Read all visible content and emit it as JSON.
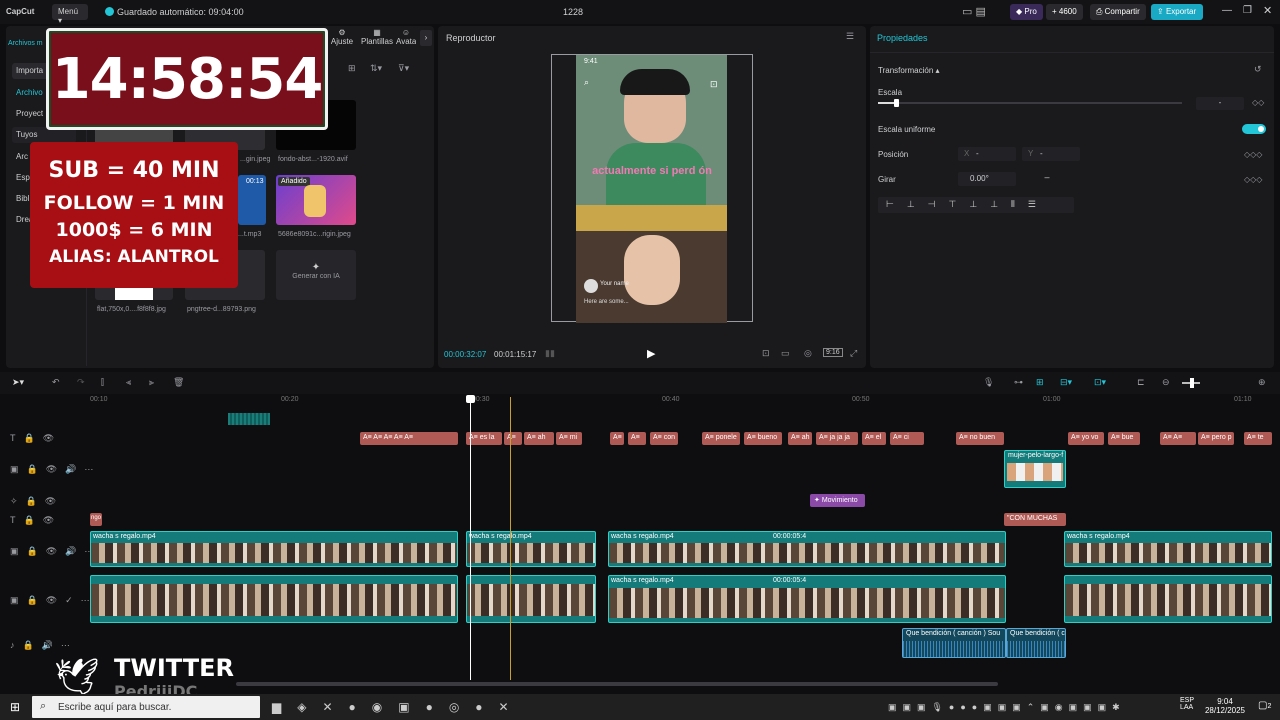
{
  "topbar": {
    "app_name": "CapCut",
    "menu_label": "Menú",
    "autosave": "Guardado automático: 09:04:00",
    "project_name": "1228",
    "pro_label": "Pro",
    "credits": "4600",
    "share_label": "Compartir",
    "export_label": "Exportar"
  },
  "media_tabs": {
    "items": [
      "Ajuste",
      "Plantillas",
      "Avata"
    ],
    "files_tab": "Archivos m"
  },
  "media_sidebar": {
    "items": [
      "Importa",
      "Archivo",
      "Proyect",
      "Tuyos",
      "Arc",
      "Esp",
      "Bibl",
      "Drea"
    ]
  },
  "media_files": [
    {
      "name": "...gin.jpeg"
    },
    {
      "name": "fondo-abst...-1920.avif"
    },
    {
      "name": "...t.mp3",
      "duration": "00:13"
    },
    {
      "name": "5686e8091c...rigin.jpeg",
      "badge": "Añadido"
    },
    {
      "name": "flat,750x,0....f8f8f8.jpg"
    },
    {
      "name": "pngtree-d...89793.png"
    }
  ],
  "media_gen": "Generar con IA",
  "overlays": {
    "clock": "14:58:54",
    "rules": [
      "SUB = 40 MIN",
      "FOLLOW = 1 MIN",
      "1000$ = 6 MIN",
      "ALIAS: ALANTROL"
    ],
    "twitter_label": "TWITTER",
    "twitter_handle": "PedriiiDC"
  },
  "player": {
    "title": "Reproductor",
    "current_time": "00:00:32:07",
    "total_time": "00:01:15:17",
    "ratio_label": "9:16",
    "phone_time": "9:41",
    "caption": "actualmente si perd ón",
    "comment_hint": "Your name",
    "comment_text": "Here are some..."
  },
  "properties": {
    "title": "Propiedades",
    "section": "Transformación",
    "scale_label": "Escala",
    "scale_value": "-",
    "scale_level": 0.06,
    "uniform_label": "Escala uniforme",
    "uniform_on": true,
    "position_label": "Posición",
    "pos_x_label": "X",
    "pos_x": "-",
    "pos_y_label": "Y",
    "pos_y": "-",
    "rotate_label": "Girar",
    "rotate_value": "0.00°",
    "rotate_dash": "–"
  },
  "timeline": {
    "ruler": [
      "00:10",
      "00:20",
      "00:30",
      "00:40",
      "00:50",
      "01:00",
      "01:10"
    ],
    "text_clips": [
      "es la",
      "ah",
      "mi",
      "con",
      "ponele",
      "bueno",
      "ah",
      "ja ja ja",
      "el",
      "ci",
      "no buen",
      "yo vo",
      "bue",
      "pero p",
      "te"
    ],
    "overlay_clip": "mujer-pelo-largo-f",
    "effect_clip": "Movimiento",
    "text_clip2": "\"CON MUCHAS",
    "start_clip": "ngo",
    "video_clip": "wacha s regalo.mp4",
    "video_clip_time": "00:00:05:4",
    "audio_clips": [
      "Que bendición ( canción ) Sou",
      "Que bendición ( c"
    ]
  },
  "taskbar": {
    "search_placeholder": "Escribe aquí para buscar.",
    "lang": "ESP",
    "lang2": "LAA",
    "time": "9:04",
    "date": "28/12/2025",
    "notif_count": "2"
  },
  "colors": {
    "accent": "#22c6d6",
    "export": "#19a9c4",
    "text_clip": "#b05a55",
    "video_clip": "#147a7a",
    "effect_clip": "#8c4aa8",
    "playhead": "#ffffff"
  }
}
